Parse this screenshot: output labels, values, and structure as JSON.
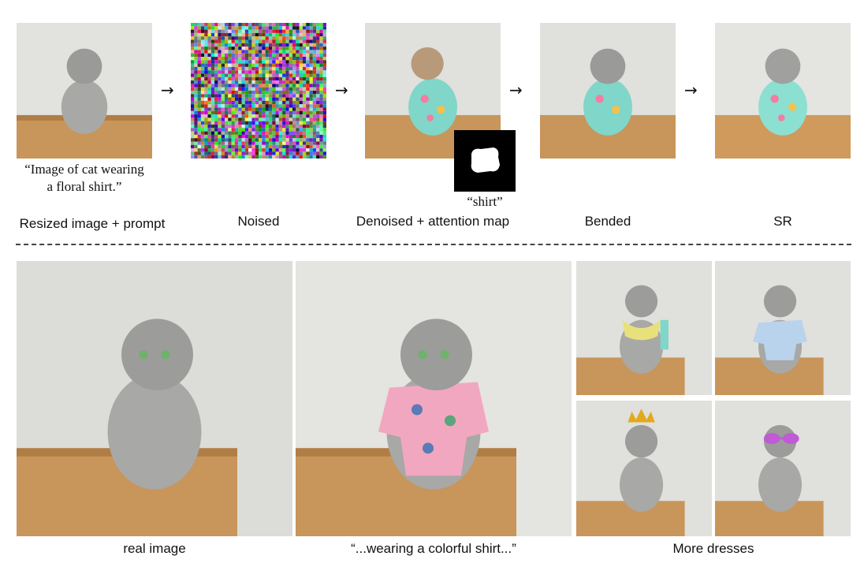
{
  "top": {
    "prompt_line1": "“Image of cat wearing",
    "prompt_line2": "a floral shirt.”",
    "mask_token": "“shirt”",
    "arrow_glyph": "→",
    "captions": {
      "resized": "Resized image + prompt",
      "noised": "Noised",
      "denoised": "Denoised + attention map",
      "blended": "Bended",
      "sr": "SR"
    }
  },
  "bottom": {
    "captions": {
      "real": "real image",
      "edited": "“...wearing a colorful shirt...”",
      "more": "More dresses"
    }
  },
  "colors": {
    "wall": "#dcdcd8",
    "shelf": "#c8955a",
    "cat": "#9a9a9a",
    "shirt_floral": "#7fd6c9",
    "shirt_pink": "#f2a7c0",
    "scarf": "#e8e07a",
    "shirt_blue": "#b9d3ec",
    "crown": "#e3a91c",
    "glasses": "#c05ad6"
  }
}
